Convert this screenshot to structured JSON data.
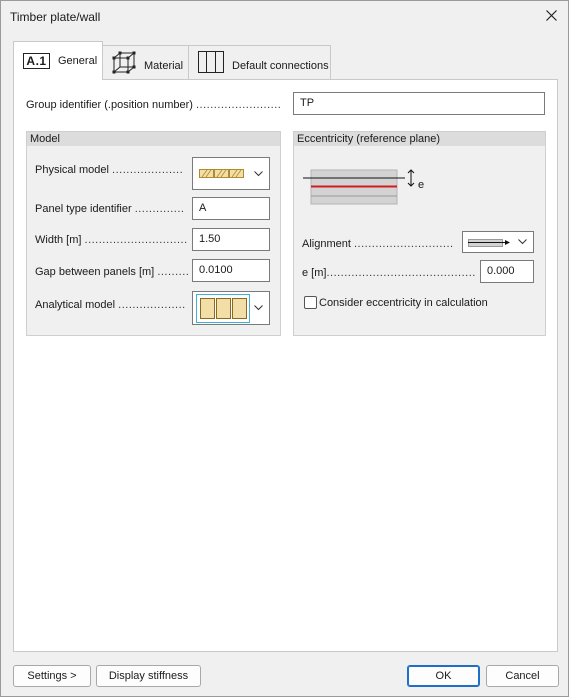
{
  "window": {
    "title": "Timber plate/wall"
  },
  "tabs": [
    {
      "label": "General",
      "icon": "a1-icon",
      "icon_text": "A.1"
    },
    {
      "label": "Material",
      "icon": "material-cube-icon"
    },
    {
      "label": "Default connections",
      "icon": "connections-icon"
    }
  ],
  "general": {
    "group_identifier": {
      "label": "Group identifier (.position number)",
      "dots": "........................",
      "value": "TP"
    }
  },
  "model": {
    "title": "Model",
    "physical_model": {
      "label": "Physical model",
      "dots": "...................."
    },
    "panel_type": {
      "label": "Panel type identifier",
      "dots": "..............",
      "value": "A"
    },
    "width": {
      "label": "Width [m]",
      "dots": ".............................",
      "value": "1.50"
    },
    "gap": {
      "label": "Gap between panels [m]",
      "dots": ".........",
      "value": "0.0100"
    },
    "analytical_model": {
      "label": "Analytical model",
      "dots": "..................."
    }
  },
  "eccentricity": {
    "title": "Eccentricity (reference plane)",
    "diagram_e": "e",
    "alignment": {
      "label": "Alignment",
      "dots": "............................"
    },
    "e": {
      "label": "e [m]",
      "dots": "..........................................",
      "value": "0.000"
    },
    "consider": {
      "label": "Consider eccentricity in calculation",
      "checked": false
    }
  },
  "footer": {
    "settings": "Settings >",
    "display_stiffness": "Display stiffness",
    "ok": "OK",
    "cancel": "Cancel"
  },
  "colors": {
    "accent": "#1f6fc8",
    "timber": "#f3dea7",
    "timber_stroke": "#b08a2e",
    "eccentricity_line": "#d01e1e"
  }
}
